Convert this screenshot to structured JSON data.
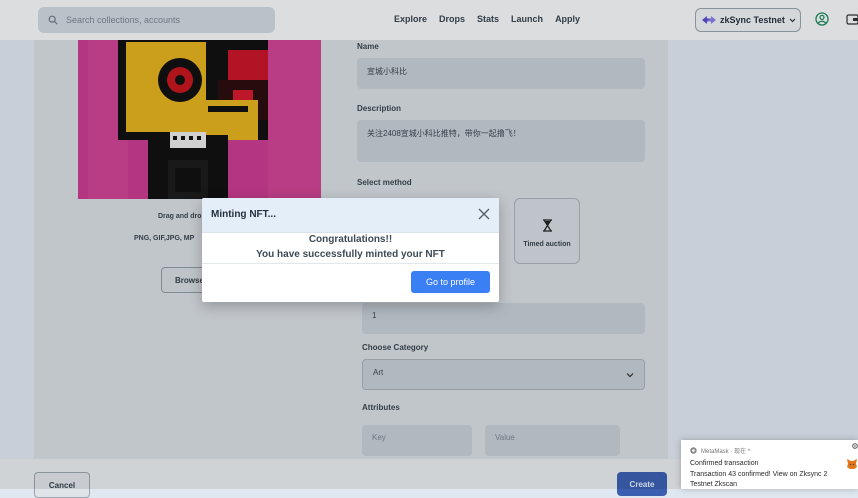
{
  "topbar": {
    "search_placeholder": "Search collections, accounts",
    "nav": [
      "Explore",
      "Drops",
      "Stats",
      "Launch",
      "Apply"
    ],
    "network": "zkSync Testnet"
  },
  "upload": {
    "drag_text": "Drag and dro",
    "formats": "PNG, GIF,JPG, MP",
    "browse_label": "Browse"
  },
  "form": {
    "name_label": "Name",
    "name_value": "宣城小科比",
    "description_label": "Description",
    "description_value": "关注2408宣城小科比推特，带你一起撸飞！",
    "select_method_label": "Select method",
    "timed_auction_label": "Timed auction",
    "quantity_value": "1",
    "category_label": "Choose Category",
    "category_value": "Art",
    "attributes_label": "Attributes",
    "key_placeholder": "Key",
    "value_placeholder": "Value"
  },
  "footer": {
    "cancel_label": "Cancel",
    "create_label": "Create"
  },
  "modal": {
    "title": "Minting NFT...",
    "line1": "Congratulations!!",
    "line2": "You have successfully minted your NFT",
    "button": "Go to profile"
  },
  "toast": {
    "app": "MetaMask · 现在 ^",
    "title": "Confirmed transaction",
    "body": "Transaction 43 confirmed! View on Zksync 2 Testnet Zkscan"
  },
  "colors": {
    "accent": "#3b7ff5",
    "create_button": "#3b5fb0",
    "artwork_background": "#c43a8f"
  }
}
